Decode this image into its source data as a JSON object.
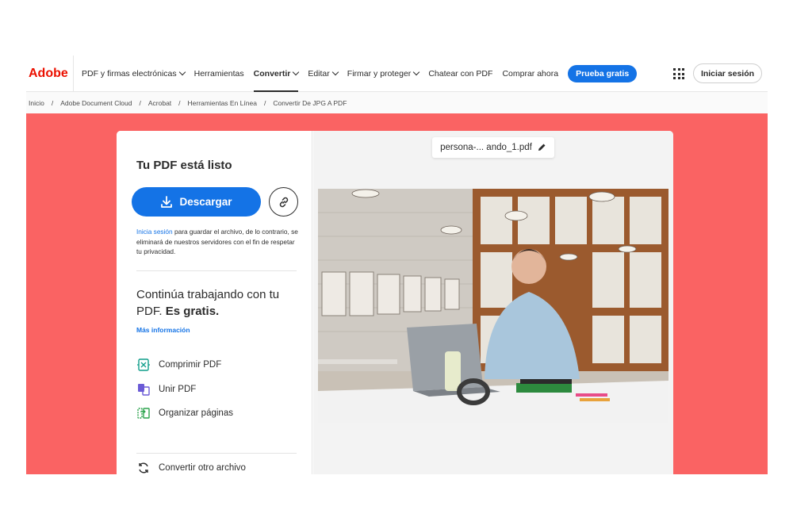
{
  "nav": {
    "logo": "Adobe",
    "items": [
      {
        "label": "PDF y firmas electrónicas",
        "dropdown": true,
        "active": false
      },
      {
        "label": "Herramientas",
        "dropdown": false,
        "active": false
      },
      {
        "label": "Convertir",
        "dropdown": true,
        "active": true
      },
      {
        "label": "Editar",
        "dropdown": true,
        "active": false
      },
      {
        "label": "Firmar y proteger",
        "dropdown": true,
        "active": false
      },
      {
        "label": "Chatear con PDF",
        "dropdown": false,
        "active": false
      },
      {
        "label": "Comprar ahora",
        "dropdown": false,
        "active": false
      }
    ],
    "trial_label": "Prueba gratis",
    "signin_label": "Iniciar sesión"
  },
  "breadcrumb": [
    "Inicio",
    "Adobe Document Cloud",
    "Acrobat",
    "Herramientas En Línea",
    "Convertir De JPG A PDF"
  ],
  "result": {
    "title": "Tu PDF está listo",
    "download_label": "Descargar",
    "notice_link": "Inicia sesión",
    "notice_text": " para guardar el archivo, de lo contrario, se eliminará de nuestros servidores con el fin de respetar tu privacidad.",
    "continue_text": "Continúa trabajando con tu PDF. ",
    "continue_bold": "Es gratis.",
    "more_info": "Más información",
    "tools": [
      {
        "label": "Comprimir PDF",
        "icon": "compress-pdf-icon"
      },
      {
        "label": "Unir PDF",
        "icon": "merge-pdf-icon"
      },
      {
        "label": "Organizar páginas",
        "icon": "organize-pages-icon"
      }
    ],
    "convert_other": "Convertir otro archivo"
  },
  "preview": {
    "filename": "persona-... ando_1.pdf"
  },
  "colors": {
    "brand_red": "#eb1000",
    "accent_blue": "#1473e6",
    "background_coral": "#fa6363"
  }
}
